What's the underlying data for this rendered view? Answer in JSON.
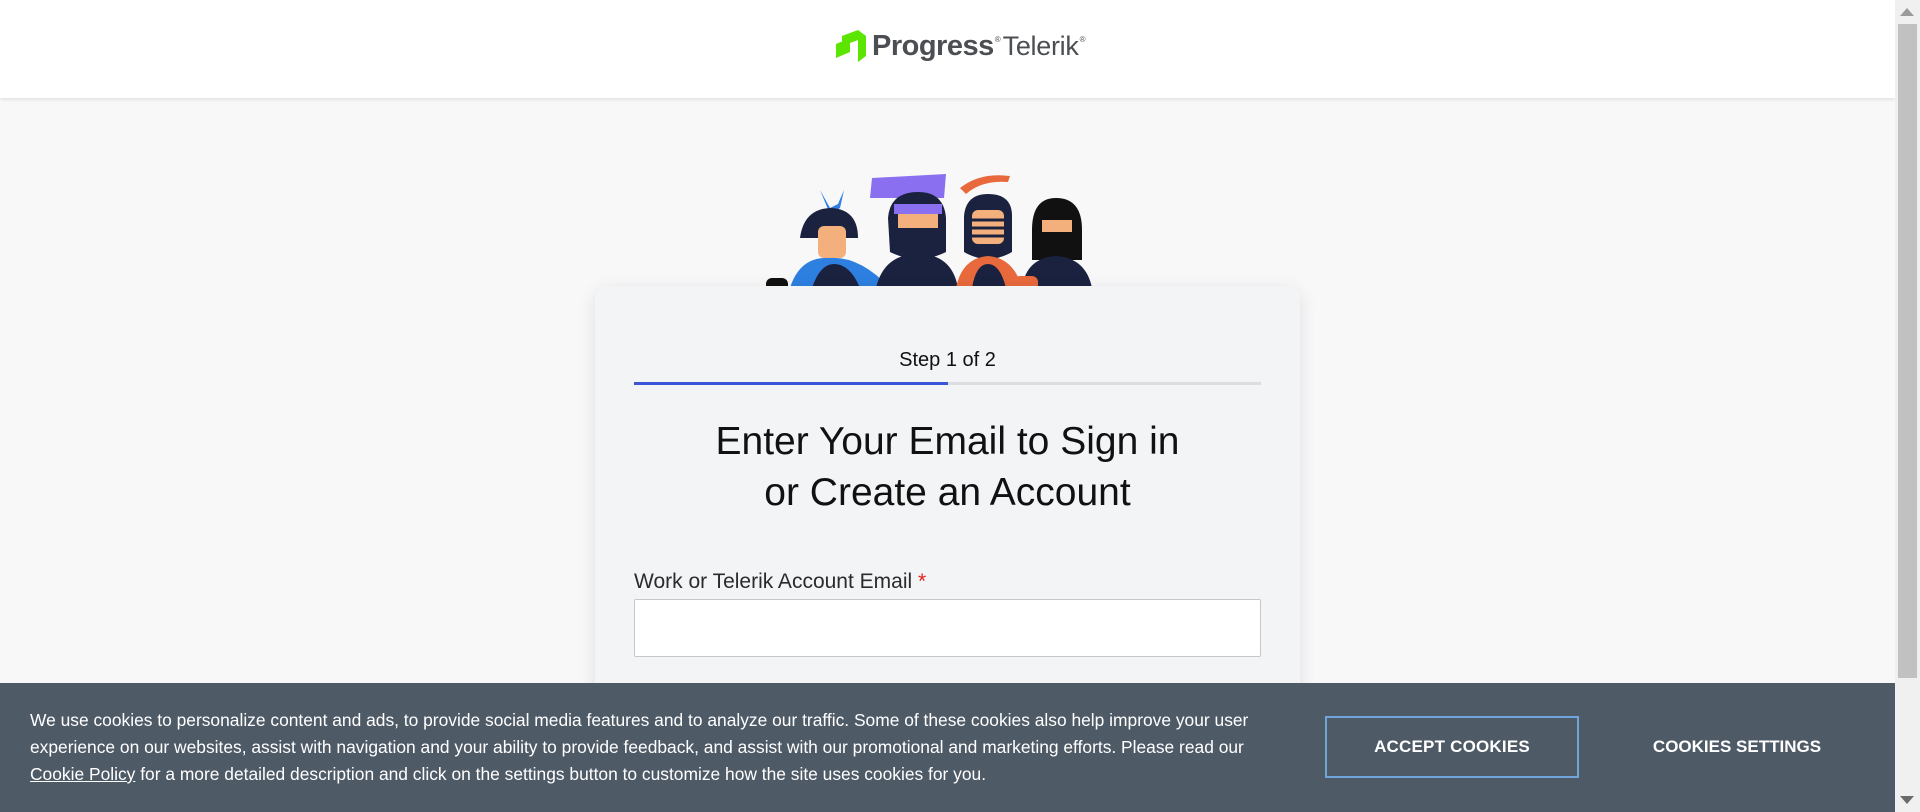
{
  "header": {
    "logo_brand": "Progress",
    "logo_product": "Telerik",
    "logo_registered": "®"
  },
  "card": {
    "step_label": "Step 1 of 2",
    "progress_fraction": 0.5,
    "heading_line1": "Enter Your Email to Sign in",
    "heading_line2": "or Create an Account",
    "email_label": "Work or Telerik Account Email",
    "required_marker": "*",
    "email_value": "",
    "email_placeholder": ""
  },
  "cookies": {
    "text_part1": "We use cookies to personalize content and ads, to provide social media features and to analyze our traffic. Some of these cookies also help improve your user experience on our websites, assist with navigation and your ability to provide feedback, and assist with our promotional and marketing efforts. Please read our ",
    "link_text": "Cookie Policy",
    "text_part2": " for a more detailed description and click on the settings button to customize how the site uses cookies for you.",
    "accept_label": "ACCEPT COOKIES",
    "settings_label": "COOKIES SETTINGS"
  },
  "colors": {
    "accent": "#3b55d9",
    "logo_green": "#5ce500",
    "cookie_bar": "#4f5a67",
    "accept_border": "#6fa5d8",
    "required": "#e02020"
  },
  "icons": [
    "progress-logo-icon",
    "ninja-mascots-illustration"
  ]
}
